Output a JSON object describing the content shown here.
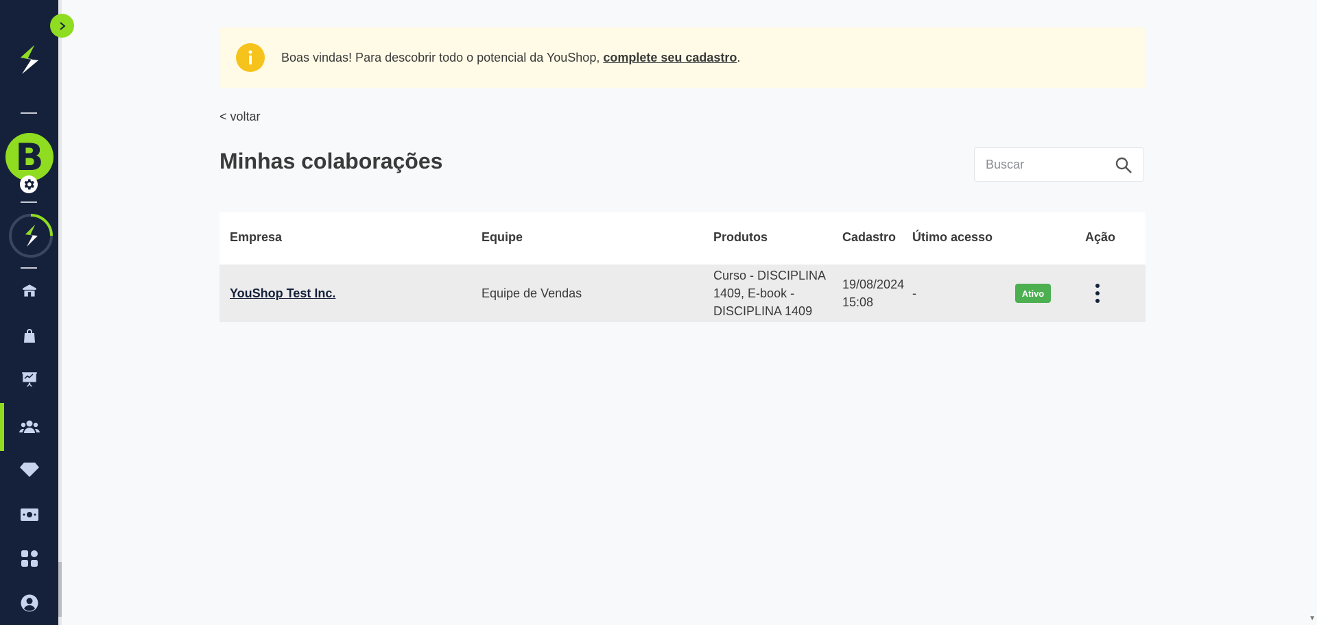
{
  "sidebar": {
    "avatar_letter": "B",
    "nav_items": [
      {
        "name": "home",
        "icon": "home-icon"
      },
      {
        "name": "shop",
        "icon": "shopping-bag-icon"
      },
      {
        "name": "dashboard",
        "icon": "presentation-chart-icon"
      },
      {
        "name": "collaborators",
        "icon": "users-icon",
        "active": true
      },
      {
        "name": "diamond",
        "icon": "diamond-icon"
      },
      {
        "name": "finance",
        "icon": "money-icon"
      },
      {
        "name": "apps",
        "icon": "apps-grid-icon"
      },
      {
        "name": "profile",
        "icon": "user-circle-icon"
      }
    ],
    "accent_color": "#8fdc21",
    "background_color": "#15213a"
  },
  "banner": {
    "text": "Boas vindas! Para descobrir todo o potencial da YouShop, ",
    "link_label": "complete seu cadastro",
    "suffix": "."
  },
  "back_label": "< voltar",
  "page_title": "Minhas colaborações",
  "search": {
    "placeholder": "Buscar"
  },
  "table": {
    "headers": {
      "empresa": "Empresa",
      "equipe": "Equipe",
      "produtos": "Produtos",
      "cadastro": "Cadastro",
      "ultimo_acesso": "Útimo acesso",
      "acao": "Ação"
    },
    "rows": [
      {
        "empresa": "YouShop Test Inc.",
        "equipe": "Equipe de Vendas",
        "produtos_lines": [
          "Curso - DISCIPLINA",
          "1409, E-book -",
          "DISCIPLINA 1409"
        ],
        "cadastro_lines": [
          "19/08/2024",
          "15:08"
        ],
        "ultimo_acesso": "-",
        "status": "Ativo",
        "status_color": "#4caf50"
      }
    ]
  }
}
